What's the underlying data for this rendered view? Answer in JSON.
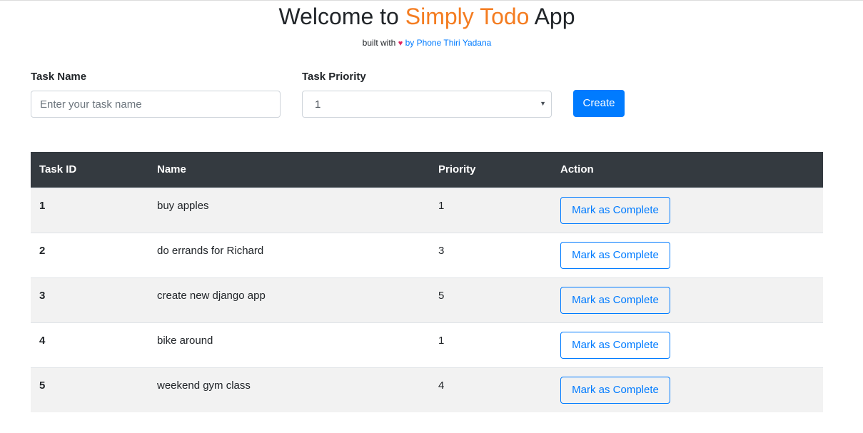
{
  "header": {
    "title_prefix": "Welcome to ",
    "title_brand": "Simply Todo",
    "title_suffix": " App",
    "byline_prefix": "built with ",
    "heart": "♥",
    "author_link": "by Phone Thiri Yadana"
  },
  "form": {
    "task_name_label": "Task Name",
    "task_name_placeholder": "Enter your task name",
    "task_priority_label": "Task Priority",
    "task_priority_selected": "1",
    "create_label": "Create"
  },
  "table": {
    "headers": [
      "Task ID",
      "Name",
      "Priority",
      "Action"
    ],
    "rows": [
      {
        "id": "1",
        "name": "buy apples",
        "priority": "1",
        "action": "Mark as Complete"
      },
      {
        "id": "2",
        "name": "do errands for Richard",
        "priority": "3",
        "action": "Mark as Complete"
      },
      {
        "id": "3",
        "name": "create new django app",
        "priority": "5",
        "action": "Mark as Complete"
      },
      {
        "id": "4",
        "name": "bike around",
        "priority": "1",
        "action": "Mark as Complete"
      },
      {
        "id": "5",
        "name": "weekend gym class",
        "priority": "4",
        "action": "Mark as Complete"
      }
    ]
  },
  "colors": {
    "brand": "#f47c20",
    "primary": "#007bff",
    "table_header_bg": "#343a40",
    "heart": "#e0245e"
  }
}
